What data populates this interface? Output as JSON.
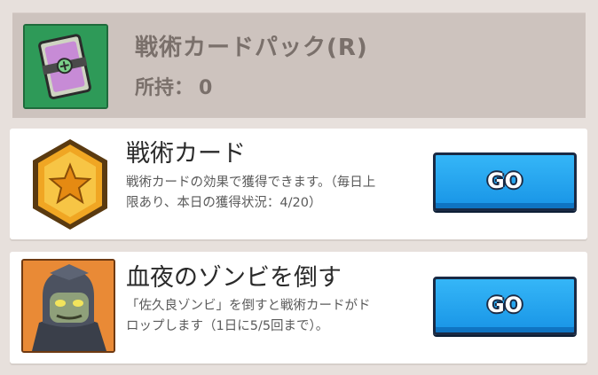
{
  "header": {
    "title": "戦術カードパック(R)",
    "owned_label": "所持：",
    "owned_count": "0"
  },
  "tasks": [
    {
      "title": "戦術カード",
      "description": "戦術カードの効果で獲得できます。（毎日上限あり、本日の獲得状況：4/20）",
      "button": "GO"
    },
    {
      "title": "血夜のゾンビを倒す",
      "description": "「佐久良ゾンビ」を倒すと戦術カードがドロップします（1日に5/5回まで）。",
      "button": "GO"
    }
  ],
  "colors": {
    "background": "#e7e0dc",
    "header_bg": "#cdc3be",
    "button_blue": "#1894e6",
    "pack_green": "#2e9a58",
    "hex_gold": "#f5a51f",
    "zombie_orange": "#e98a36"
  }
}
